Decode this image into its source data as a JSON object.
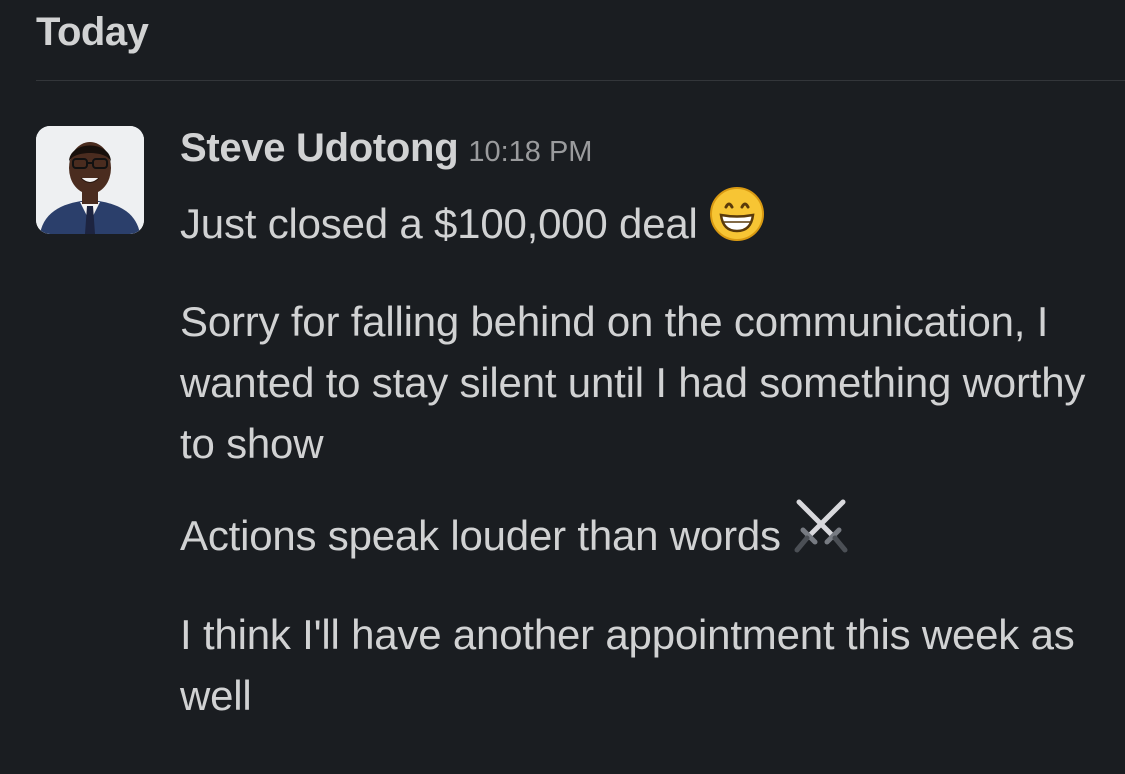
{
  "day_header": "Today",
  "message": {
    "author": "Steve Udotong",
    "time": "10:18 PM",
    "avatar_icon": "profile-photo",
    "lines": [
      {
        "text": "Just closed a $100,000 deal",
        "emoji": "grinning-face-icon"
      },
      {
        "text": "Sorry for falling behind on the communication, I wanted to stay silent until I had something worthy to show"
      },
      {
        "text": "Actions speak louder than words",
        "emoji": "crossed-swords-icon"
      },
      {
        "text": "I think I'll have another appointment this week as well"
      }
    ]
  }
}
